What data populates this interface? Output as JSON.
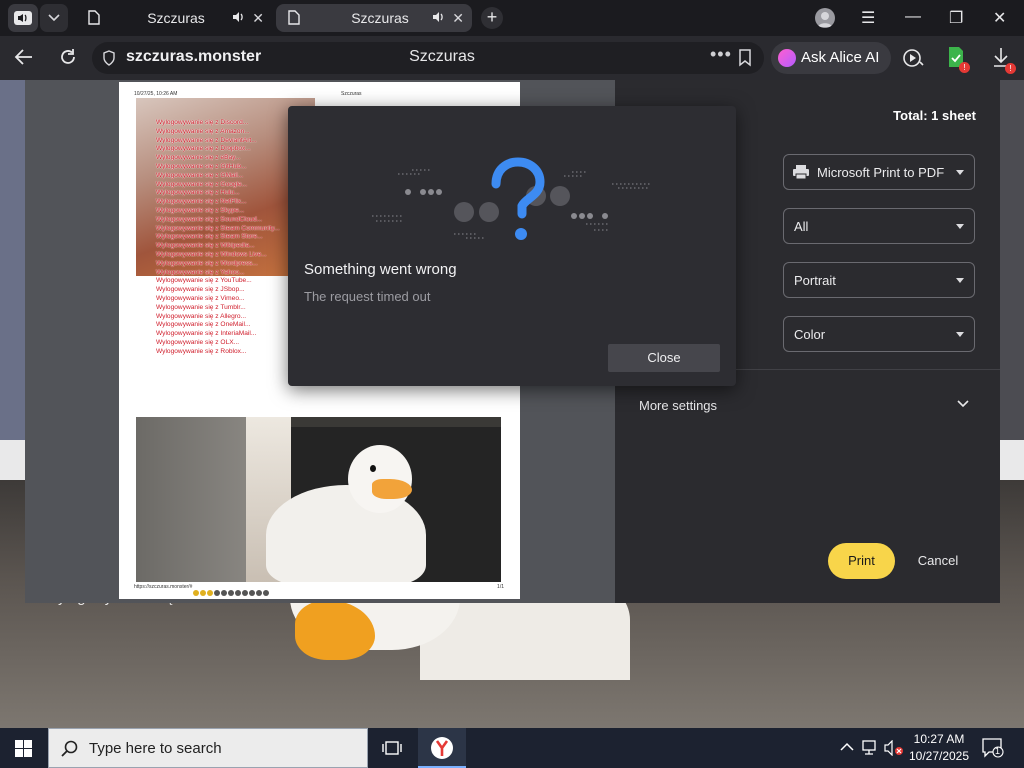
{
  "browser": {
    "tabs": [
      {
        "label": "Szczuras"
      },
      {
        "label": "Szczuras"
      }
    ],
    "address": "szczuras.monster",
    "page_title": "Szczuras",
    "alice_label": "Ask Alice AI",
    "badge_count": "!",
    "accent_color": "#f8d54a"
  },
  "print_preview": {
    "header_left": "10/27/25, 10:26 AM",
    "header_center": "Szczuras",
    "footer_left": "https://szczuras.monster/#",
    "footer_right": "1/1",
    "logout_lines": [
      "Wylogowywanie się z Discord...",
      "Wylogowywanie się z Amazon...",
      "Wylogowywanie się z DeviantArt...",
      "Wylogowywanie się z Dropbox...",
      "Wylogowywanie się z eBay...",
      "Wylogowywanie się z GitHub...",
      "Wylogowywanie się z GMail...",
      "Wylogowywanie się z Google...",
      "Wylogowywanie się z Hulu...",
      "Wylogowywanie się z NetFlix...",
      "Wylogowywanie się z Skype...",
      "Wylogowywanie się z SoundCloud...",
      "Wylogowywanie się z Steam Community...",
      "Wylogowywanie się z Steam Store...",
      "Wylogowywanie się z Wikipedia...",
      "Wylogowywanie się z Windows Live...",
      "Wylogowywanie się z Wordpress...",
      "Wylogowywanie się z Yahoo...",
      "Wylogowywanie się z YouTube...",
      "Wylogowywanie się z JSbop...",
      "Wylogowywanie się z Vimeo...",
      "Wylogowywanie się z Tumblr...",
      "Wylogowywanie się z Allegro...",
      "Wylogowywanie się z OneMail...",
      "Wylogowywanie się z InteriaMail...",
      "Wylogowywanie się z OLX...",
      "Wylogowywanie się z Roblox..."
    ]
  },
  "background": {
    "caption": "Wylogowywanie się z Roblox..."
  },
  "print_settings": {
    "total": "Total: 1 sheet",
    "printer": "Microsoft Print to PDF",
    "pages": "All",
    "layout": "Portrait",
    "color": "Color",
    "more_settings": "More settings",
    "print_label": "Print",
    "cancel_label": "Cancel"
  },
  "dialog": {
    "title": "Something went wrong",
    "message": "The request timed out",
    "close_label": "Close"
  },
  "taskbar": {
    "search_placeholder": "Type here to search",
    "time": "10:27 AM",
    "date": "10/27/2025",
    "notification_count": "1"
  }
}
